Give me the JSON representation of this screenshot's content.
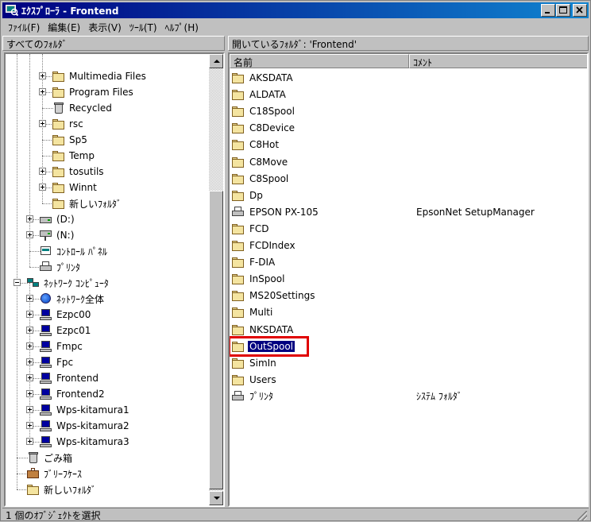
{
  "window": {
    "title": "ｴｸｽﾌﾟﾛｰﾗ - Frontend",
    "controls": [
      "minimize",
      "maximize",
      "close"
    ]
  },
  "menubar": {
    "items": [
      {
        "label": "ﾌｧｲﾙ(F)"
      },
      {
        "label": "編集(E)"
      },
      {
        "label": "表示(V)"
      },
      {
        "label": "ﾂｰﾙ(T)"
      },
      {
        "label": "ﾍﾙﾌﾟ(H)"
      }
    ]
  },
  "left_pane": {
    "header": "すべてのﾌｫﾙﾀﾞ",
    "tree": [
      {
        "label": "Multimedia Files",
        "icon": "folder-icon",
        "expander": "plus"
      },
      {
        "label": "Program Files",
        "icon": "folder-icon",
        "expander": "plus"
      },
      {
        "label": "Recycled",
        "icon": "recycle-bin-icon",
        "expander": "none"
      },
      {
        "label": "rsc",
        "icon": "folder-icon",
        "expander": "plus"
      },
      {
        "label": "Sp5",
        "icon": "folder-icon",
        "expander": "none"
      },
      {
        "label": "Temp",
        "icon": "folder-icon",
        "expander": "none"
      },
      {
        "label": "tosutils",
        "icon": "folder-icon",
        "expander": "plus"
      },
      {
        "label": "Winnt",
        "icon": "windows-folder-icon",
        "expander": "plus"
      },
      {
        "label": "新しいﾌｫﾙﾀﾞ",
        "icon": "folder-icon",
        "expander": "none"
      },
      {
        "label": "(D:)",
        "icon": "drive-icon",
        "expander": "plus"
      },
      {
        "label": "(N:)",
        "icon": "network-drive-icon",
        "expander": "plus"
      },
      {
        "label": "ｺﾝﾄﾛｰﾙ ﾊﾟﾈﾙ",
        "icon": "control-panel-icon",
        "expander": "none"
      },
      {
        "label": "ﾌﾟﾘﾝﾀ",
        "icon": "printer-folder-icon",
        "expander": "none"
      },
      {
        "label": "ﾈｯﾄﾜｰｸ ｺﾝﾋﾟｭｰﾀ",
        "icon": "network-neighborhood-icon",
        "expander": "minus"
      },
      {
        "label": "ﾈｯﾄﾜｰｸ全体",
        "icon": "globe-icon",
        "expander": "plus"
      },
      {
        "label": "Ezpc00",
        "icon": "computer-icon",
        "expander": "plus"
      },
      {
        "label": "Ezpc01",
        "icon": "computer-icon",
        "expander": "plus"
      },
      {
        "label": "Fmpc",
        "icon": "computer-icon",
        "expander": "plus"
      },
      {
        "label": "Fpc",
        "icon": "computer-icon",
        "expander": "plus"
      },
      {
        "label": "Frontend",
        "icon": "computer-icon",
        "expander": "plus"
      },
      {
        "label": "Frontend2",
        "icon": "computer-icon",
        "expander": "plus"
      },
      {
        "label": "Wps-kitamura1",
        "icon": "computer-icon",
        "expander": "plus"
      },
      {
        "label": "Wps-kitamura2",
        "icon": "computer-icon",
        "expander": "plus"
      },
      {
        "label": "Wps-kitamura3",
        "icon": "computer-icon",
        "expander": "plus"
      },
      {
        "label": "ごみ箱",
        "icon": "recycle-bin-icon",
        "expander": "none"
      },
      {
        "label": "ﾌﾞﾘｰﾌｹｰｽ",
        "icon": "briefcase-icon",
        "expander": "none"
      },
      {
        "label": "新しいﾌｫﾙﾀﾞ",
        "icon": "folder-icon",
        "expander": "none"
      }
    ]
  },
  "right_pane": {
    "header": "開いているﾌｫﾙﾀﾞ: 'Frontend'",
    "columns": [
      "名前",
      "ｺﾒﾝﾄ"
    ],
    "items": [
      {
        "name": "AKSDATA",
        "comment": "",
        "icon": "folder-icon"
      },
      {
        "name": "ALDATA",
        "comment": "",
        "icon": "folder-icon"
      },
      {
        "name": "C18Spool",
        "comment": "",
        "icon": "folder-icon"
      },
      {
        "name": "C8Device",
        "comment": "",
        "icon": "folder-icon"
      },
      {
        "name": "C8Hot",
        "comment": "",
        "icon": "folder-icon"
      },
      {
        "name": "C8Move",
        "comment": "",
        "icon": "folder-icon"
      },
      {
        "name": "C8Spool",
        "comment": "",
        "icon": "folder-icon"
      },
      {
        "name": "Dp",
        "comment": "",
        "icon": "folder-icon"
      },
      {
        "name": "EPSON PX-105",
        "comment": "EpsonNet SetupManager",
        "icon": "printer-icon"
      },
      {
        "name": "FCD",
        "comment": "",
        "icon": "folder-icon"
      },
      {
        "name": "FCDIndex",
        "comment": "",
        "icon": "folder-icon"
      },
      {
        "name": "F-DIA",
        "comment": "",
        "icon": "folder-icon"
      },
      {
        "name": "InSpool",
        "comment": "",
        "icon": "folder-icon"
      },
      {
        "name": "MS20Settings",
        "comment": "",
        "icon": "folder-icon"
      },
      {
        "name": "Multi",
        "comment": "",
        "icon": "folder-icon"
      },
      {
        "name": "NKSDATA",
        "comment": "",
        "icon": "folder-icon"
      },
      {
        "name": "OutSpool",
        "comment": "",
        "icon": "folder-icon",
        "selected": true
      },
      {
        "name": "SimIn",
        "comment": "",
        "icon": "folder-icon"
      },
      {
        "name": "Users",
        "comment": "",
        "icon": "folder-icon"
      },
      {
        "name": "ﾌﾟﾘﾝﾀ",
        "comment": "ｼｽﾃﾑ ﾌｫﾙﾀﾞ",
        "icon": "printer-folder-icon"
      }
    ]
  },
  "statusbar": {
    "text": "1 個のｵﾌﾞｼﾞｪｸﾄを選択"
  },
  "colors": {
    "titlebar_start": "#000080",
    "titlebar_end": "#1084d0",
    "selection": "#000080",
    "highlight_box": "#e00000",
    "window_face": "#c0c0c0"
  }
}
